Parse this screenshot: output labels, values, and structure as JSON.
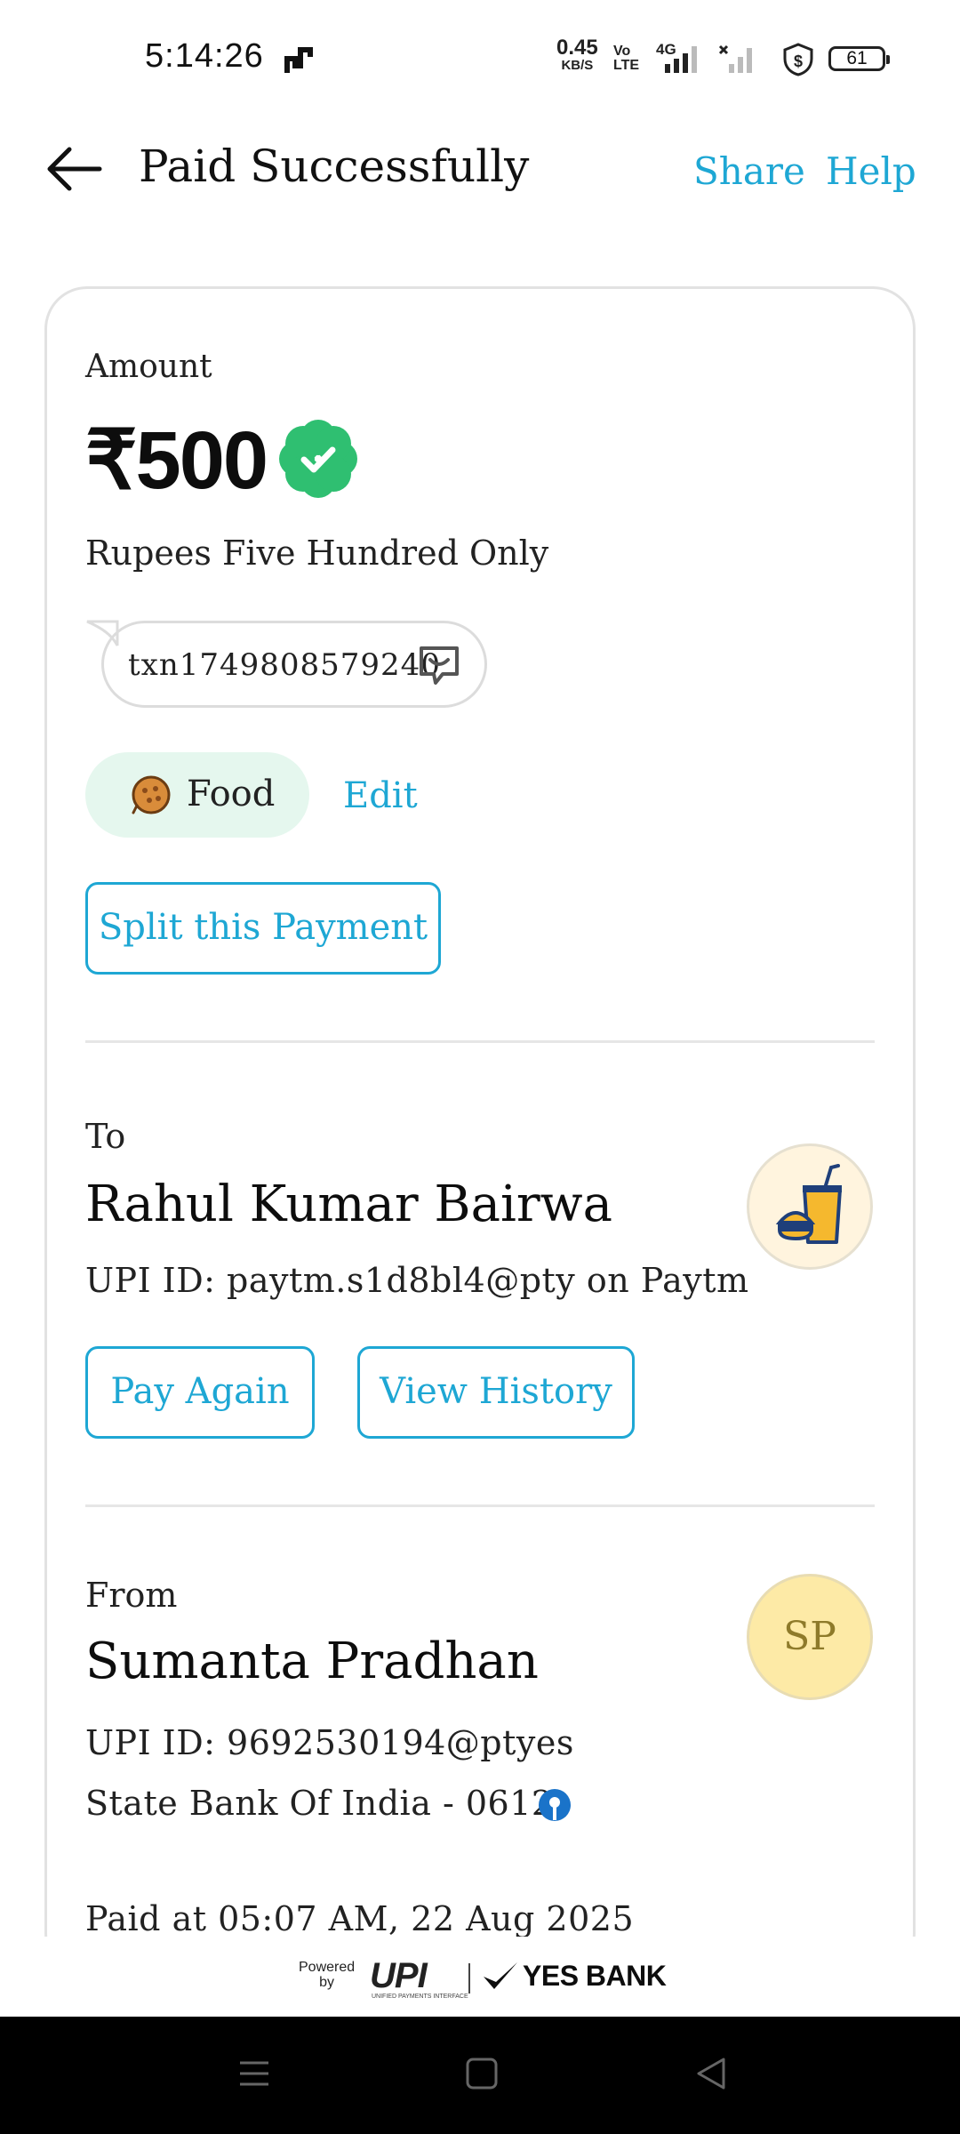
{
  "status_bar": {
    "time": "5:14:26",
    "net_speed_value": "0.45",
    "net_speed_unit": "KB/S",
    "volte_top": "Vo",
    "volte_bottom": "LTE",
    "network": "4G",
    "battery": "61",
    "icons": [
      "activity-icon",
      "volte-icon",
      "signal-icon",
      "no-signal-icon",
      "vpn-shield-icon",
      "battery-icon"
    ]
  },
  "header": {
    "title": "Paid Successfully",
    "share": "Share",
    "help": "Help"
  },
  "payment": {
    "amount_label": "Amount",
    "amount": "₹500",
    "amount_words": "Rupees Five Hundred Only",
    "txn_id": "txn1749808579240",
    "tag": "Food",
    "edit": "Edit",
    "split": "Split this Payment"
  },
  "to": {
    "label": "To",
    "name": "Rahul Kumar Bairwa",
    "upi": "UPI ID: paytm.s1d8bl4@pty on Paytm",
    "pay_again": "Pay Again",
    "view_history": "View History"
  },
  "from": {
    "label": "From",
    "name": "Sumanta Pradhan",
    "initials": "SP",
    "upi": "UPI ID: 9692530194@ptyes",
    "bank": "State Bank Of India - 0612"
  },
  "paid_at": "Paid at 05:07 AM, 22 Aug 2025",
  "footer": {
    "powered_top": "Powered",
    "powered_bottom": "by",
    "upi": "UPI",
    "upi_sub": "UNIFIED PAYMENTS INTERFACE",
    "bank": "YES BANK"
  },
  "colors": {
    "accent": "#1ea7d4",
    "success": "#2fbf71",
    "tag_bg": "#e5f7ee"
  }
}
